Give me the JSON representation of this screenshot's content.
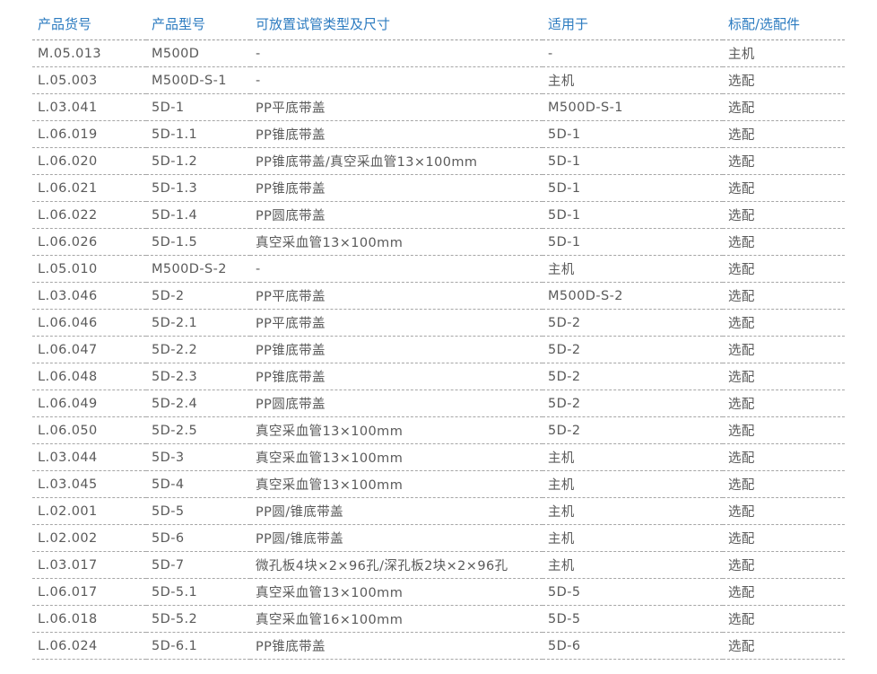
{
  "table": {
    "headers": [
      "产品货号",
      "产品型号",
      "可放置试管类型及尺寸",
      "适用于",
      "标配/选配件"
    ],
    "rows": [
      [
        "M.05.013",
        "M500D",
        "-",
        "-",
        "主机"
      ],
      [
        "L.05.003",
        "M500D-S-1",
        "-",
        "主机",
        "选配"
      ],
      [
        "L.03.041",
        "5D-1",
        "PP平底带盖",
        "M500D-S-1",
        "选配"
      ],
      [
        "L.06.019",
        "5D-1.1",
        "PP锥底带盖",
        "5D-1",
        "选配"
      ],
      [
        "L.06.020",
        "5D-1.2",
        "PP锥底带盖/真空采血管13×100mm",
        "5D-1",
        "选配"
      ],
      [
        "L.06.021",
        "5D-1.3",
        "PP锥底带盖",
        "5D-1",
        "选配"
      ],
      [
        "L.06.022",
        "5D-1.4",
        "PP圆底带盖",
        "5D-1",
        "选配"
      ],
      [
        "L.06.026",
        "5D-1.5",
        "真空采血管13×100mm",
        "5D-1",
        "选配"
      ],
      [
        "L.05.010",
        "M500D-S-2",
        "-",
        "主机",
        "选配"
      ],
      [
        "L.03.046",
        "5D-2",
        "PP平底带盖",
        "M500D-S-2",
        "选配"
      ],
      [
        "L.06.046",
        "5D-2.1",
        "PP平底带盖",
        "5D-2",
        "选配"
      ],
      [
        "L.06.047",
        "5D-2.2",
        "PP锥底带盖",
        "5D-2",
        "选配"
      ],
      [
        "L.06.048",
        "5D-2.3",
        "PP锥底带盖",
        "5D-2",
        "选配"
      ],
      [
        "L.06.049",
        "5D-2.4",
        "PP圆底带盖",
        "5D-2",
        "选配"
      ],
      [
        "L.06.050",
        "5D-2.5",
        "真空采血管13×100mm",
        "5D-2",
        "选配"
      ],
      [
        "L.03.044",
        "5D-3",
        "真空采血管13×100mm",
        "主机",
        "选配"
      ],
      [
        "L.03.045",
        "5D-4",
        "真空采血管13×100mm",
        "主机",
        "选配"
      ],
      [
        "L.02.001",
        "5D-5",
        "PP圆/锥底带盖",
        "主机",
        "选配"
      ],
      [
        "L.02.002",
        "5D-6",
        "PP圆/锥底带盖",
        "主机",
        "选配"
      ],
      [
        "L.03.017",
        "5D-7",
        "微孔板4块×2×96孔/深孔板2块×2×96孔",
        "主机",
        "选配"
      ],
      [
        "L.06.017",
        "5D-5.1",
        "真空采血管13×100mm",
        "5D-5",
        "选配"
      ],
      [
        "L.06.018",
        "5D-5.2",
        "真空采血管16×100mm",
        "5D-5",
        "选配"
      ],
      [
        "L.06.024",
        "5D-6.1",
        "PP锥底带盖",
        "5D-6",
        "选配"
      ]
    ]
  },
  "colors": {
    "header_text": "#2c7bc0",
    "body_text": "#5a5a5a",
    "divider": "#a6a6a6"
  }
}
